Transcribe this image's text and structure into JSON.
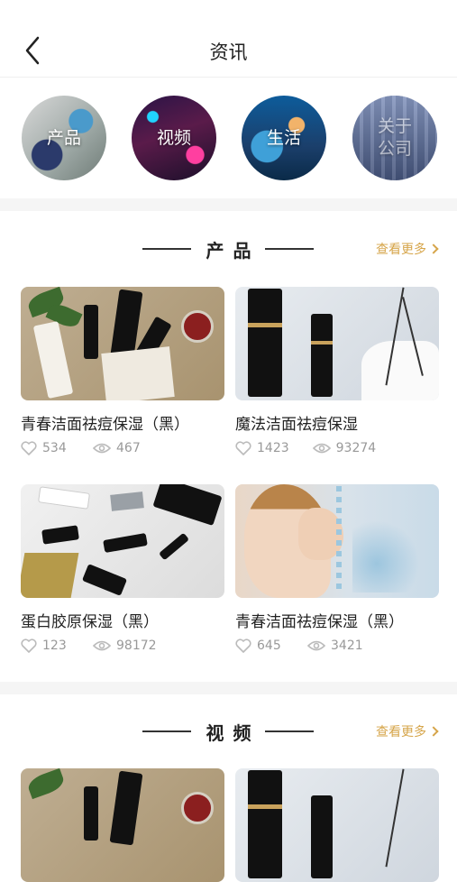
{
  "header": {
    "title": "资讯",
    "back_icon": "chevron-left-icon"
  },
  "categories": [
    {
      "label_lines": [
        "产品"
      ]
    },
    {
      "label_lines": [
        "视频"
      ]
    },
    {
      "label_lines": [
        "生活"
      ]
    },
    {
      "label_lines": [
        "关于",
        "公司"
      ]
    }
  ],
  "sections": [
    {
      "title": "产品",
      "more": "查看更多",
      "cards": [
        {
          "name": "青春洁面祛痘保湿（黑）",
          "likes": "534",
          "views": "467"
        },
        {
          "name": "魔法洁面祛痘保湿",
          "likes": "1423",
          "views": "93274"
        },
        {
          "name": "蛋白胶原保湿（黑）",
          "likes": "123",
          "views": "98172"
        },
        {
          "name": "青春洁面祛痘保湿（黑）",
          "likes": "645",
          "views": "3421"
        }
      ]
    },
    {
      "title": "视频",
      "more": "查看更多"
    }
  ],
  "colors": {
    "accent": "#d6a54a",
    "muted": "#999999",
    "divider": "#f5f5f5"
  }
}
